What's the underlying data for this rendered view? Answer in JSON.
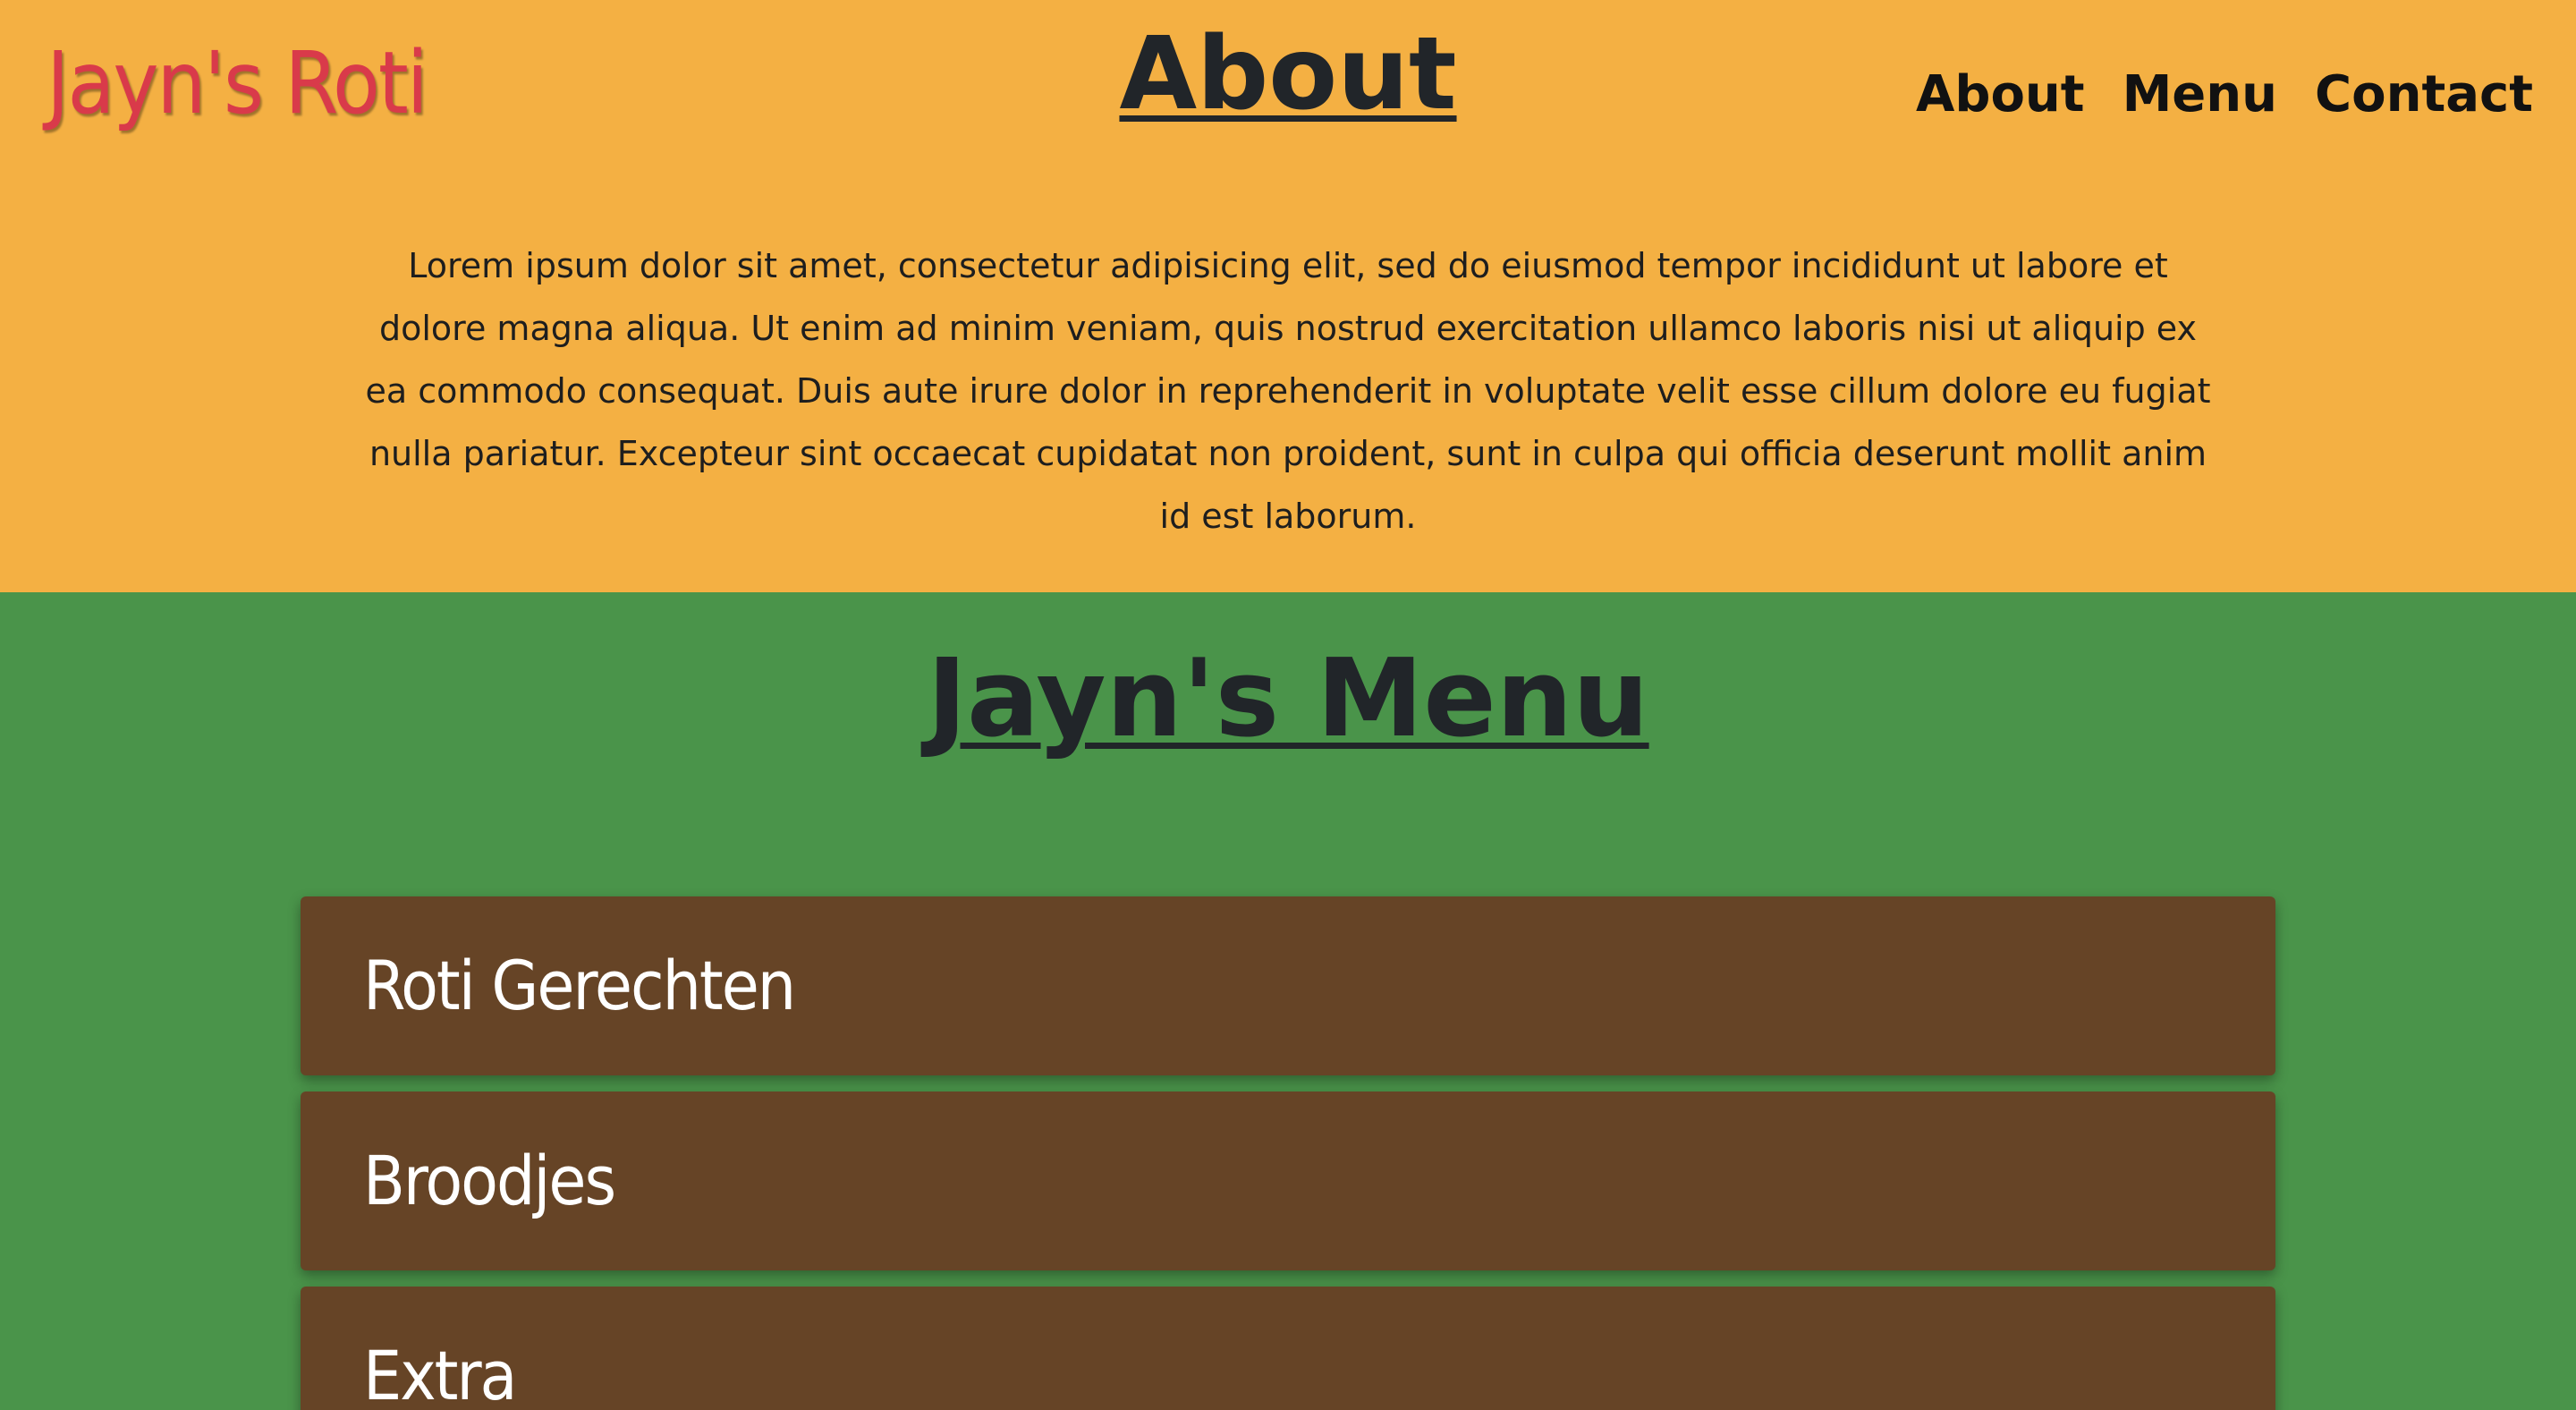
{
  "header": {
    "brand": "Jayn's Roti",
    "nav": [
      "About",
      "Menu",
      "Contact"
    ]
  },
  "about": {
    "title": "About",
    "text": "Lorem ipsum dolor sit amet, consectetur adipisicing elit, sed do eiusmod tempor incididunt ut labore et dolore magna aliqua. Ut enim ad minim veniam, quis nostrud exercitation ullamco laboris nisi ut aliquip ex ea commodo consequat. Duis aute irure dolor in reprehenderit in voluptate velit esse cillum dolore eu fugiat nulla pariatur. Excepteur sint occaecat cupidatat non proident, sunt in culpa qui officia deserunt mollit anim id est laborum."
  },
  "menu": {
    "title": "Jayn's Menu",
    "categories": [
      "Roti Gerechten",
      "Broodjes",
      "Extra"
    ]
  },
  "colors": {
    "about_bg": "#f4b043",
    "menu_bg": "#4a944a",
    "card_bg": "#664426",
    "brand": "#d93a4a"
  }
}
